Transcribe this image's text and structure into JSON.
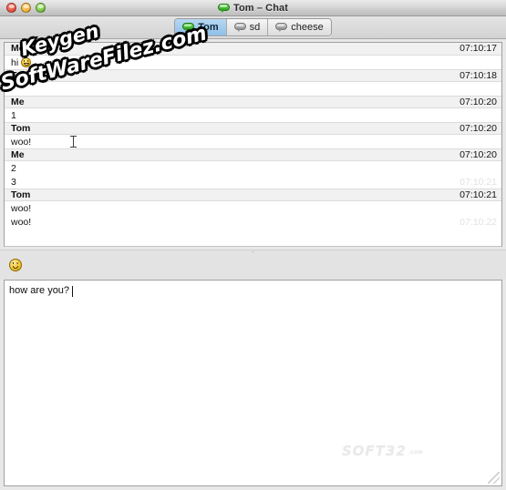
{
  "window": {
    "title": "Tom – Chat",
    "title_icon": "chat-bubble-icon",
    "controls": {
      "close": "close-button",
      "minimize": "minimize-button",
      "zoom": "zoom-button"
    }
  },
  "tabs": [
    {
      "label": "Tom",
      "icon": "chat-bubble-icon",
      "active": true
    },
    {
      "label": "sd",
      "icon": "chat-bubble-icon",
      "active": false
    },
    {
      "label": "cheese",
      "icon": "chat-bubble-icon",
      "active": false
    }
  ],
  "conversation": {
    "entries": [
      {
        "type": "header",
        "sender": "Me",
        "time": "07:10:17"
      },
      {
        "type": "line",
        "text": "hi",
        "emoji": "grinning-face",
        "time": ""
      },
      {
        "type": "header",
        "sender": "Tom",
        "time": "07:10:18"
      },
      {
        "type": "line",
        "text": "",
        "emoji": "",
        "time": ""
      },
      {
        "type": "header",
        "sender": "Me",
        "time": "07:10:20"
      },
      {
        "type": "line",
        "text": "1",
        "emoji": "",
        "time": ""
      },
      {
        "type": "header",
        "sender": "Tom",
        "time": "07:10:20"
      },
      {
        "type": "line",
        "text": "woo!",
        "emoji": "",
        "time": ""
      },
      {
        "type": "header",
        "sender": "Me",
        "time": "07:10:20"
      },
      {
        "type": "line",
        "text": "2",
        "emoji": "",
        "time": ""
      },
      {
        "type": "line",
        "text": "3",
        "emoji": "",
        "time": "07:10:21"
      },
      {
        "type": "header",
        "sender": "Tom",
        "time": "07:10:21"
      },
      {
        "type": "line",
        "text": "woo!",
        "emoji": "",
        "time": ""
      },
      {
        "type": "line",
        "text": "woo!",
        "emoji": "",
        "time": "07:10:22"
      }
    ]
  },
  "toolbar": {
    "emoji_button": "smiley-icon",
    "tiny_mark": "˘"
  },
  "composer": {
    "value": "how are you?",
    "placeholder": ""
  },
  "watermarks": {
    "keygen_line1": "Keygen",
    "keygen_line2": "SoftWareFilez.com",
    "footer_brand": "SOFT32",
    "footer_suffix": ".com"
  },
  "colors": {
    "active_tab": "#8fc0e8",
    "header_row": "#f1f1f1",
    "bubble_green": "#2ca31c",
    "faint_stamp": "#e2e2e2"
  }
}
